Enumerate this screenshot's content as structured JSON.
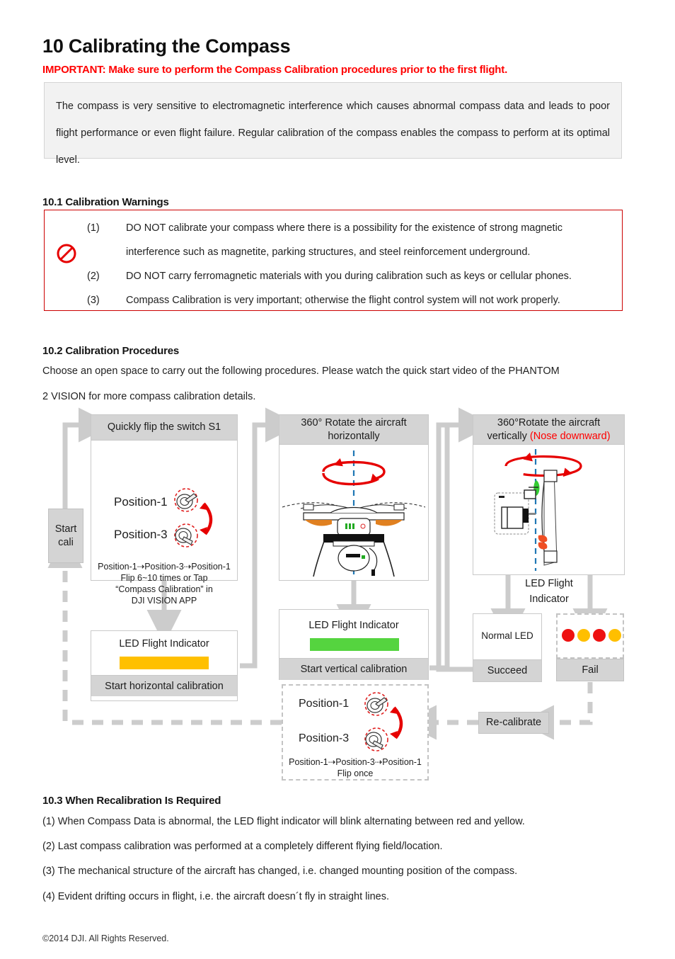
{
  "chapter": {
    "title": "10 Calibrating the Compass",
    "important": "IMPORTANT: Make sure to perform the Compass Calibration procedures prior to the first flight.",
    "intro": "The compass is very sensitive to electromagnetic interference which causes abnormal compass data and leads to poor flight performance or even flight failure. Regular calibration of the compass enables the compass to perform at its optimal level."
  },
  "section_10_1": {
    "heading": "10.1 Calibration Warnings",
    "icon": "prohibition-icon",
    "items": [
      {
        "num": "(1)",
        "text": "DO NOT calibrate your compass where there is a possibility for the existence of strong magnetic interference such as magnetite, parking structures, and steel reinforcement underground."
      },
      {
        "num": "(2)",
        "text": "DO NOT carry ferromagnetic materials with you during calibration such as keys or cellular phones."
      },
      {
        "num": "(3)",
        "text": "Compass Calibration is very important; otherwise the flight control system will not work properly."
      }
    ]
  },
  "section_10_2": {
    "heading": "10.2 Calibration Procedures",
    "para_line1": "Choose an open space to carry out the following procedures. Please watch the quick start video of the PHANTOM",
    "para_line2": "2 VISION for more compass calibration details.",
    "flow": {
      "start": "Start\ncali",
      "start_line1": "Start",
      "start_line2": "cali",
      "step1": {
        "header": "Quickly flip the switch S1",
        "pos1_label": "Position-1",
        "pos3_label": "Position-3",
        "caption_line1": "Position-1⇢Position-3⇢Position-1",
        "caption_line2": "Flip 6~10 times or Tap",
        "caption_line3": "“Compass Calibration” in",
        "caption_line4": "DJI VISION APP"
      },
      "step1_led": {
        "title": "LED Flight Indicator",
        "bar_color": "#ffc000",
        "footer": "Start horizontal calibration"
      },
      "step2": {
        "header_line1": "360° Rotate the aircraft",
        "header_line2": "horizontally",
        "illustration": "phantom-drone-horizontal"
      },
      "step2_led": {
        "title": "LED Flight Indicator",
        "bar_color": "#55d43f",
        "footer": "Start vertical calibration"
      },
      "step3": {
        "header_line1": "360°Rotate the aircraft",
        "header_line2_a": "vertically ",
        "header_line2_b": "(Nose downward)",
        "illustration": "phantom-drone-vertical"
      },
      "step3_label_line1": "LED Flight",
      "step3_label_line2": "Indicator",
      "succeed": {
        "body": "Normal LED",
        "footer": "Succeed"
      },
      "fail": {
        "footer": "Fail",
        "dots": [
          "#ee1111",
          "#ffbf00",
          "#ee1111",
          "#ffbf00"
        ]
      },
      "recalibrate": "Re-calibrate",
      "recal_flip": {
        "pos1_label": "Position-1",
        "pos3_label": "Position-3",
        "caption_line1": "Position-1⇢Position-3⇢Position-1",
        "caption_line2": "Flip once"
      }
    }
  },
  "section_10_3": {
    "heading": "10.3 When Recalibration Is Required",
    "items": [
      "(1) When Compass Data is abnormal, the LED flight indicator will blink alternating between red and yellow.",
      "(2) Last compass calibration was performed at a completely different flying field/location.",
      "(3) The mechanical structure of the aircraft has changed, i.e. changed mounting position of the compass.",
      "(4) Evident drifting occurs in flight, i.e. the aircraft doesn´t fly in straight lines."
    ]
  },
  "footer": "©2014 DJI. All Rights Reserved."
}
